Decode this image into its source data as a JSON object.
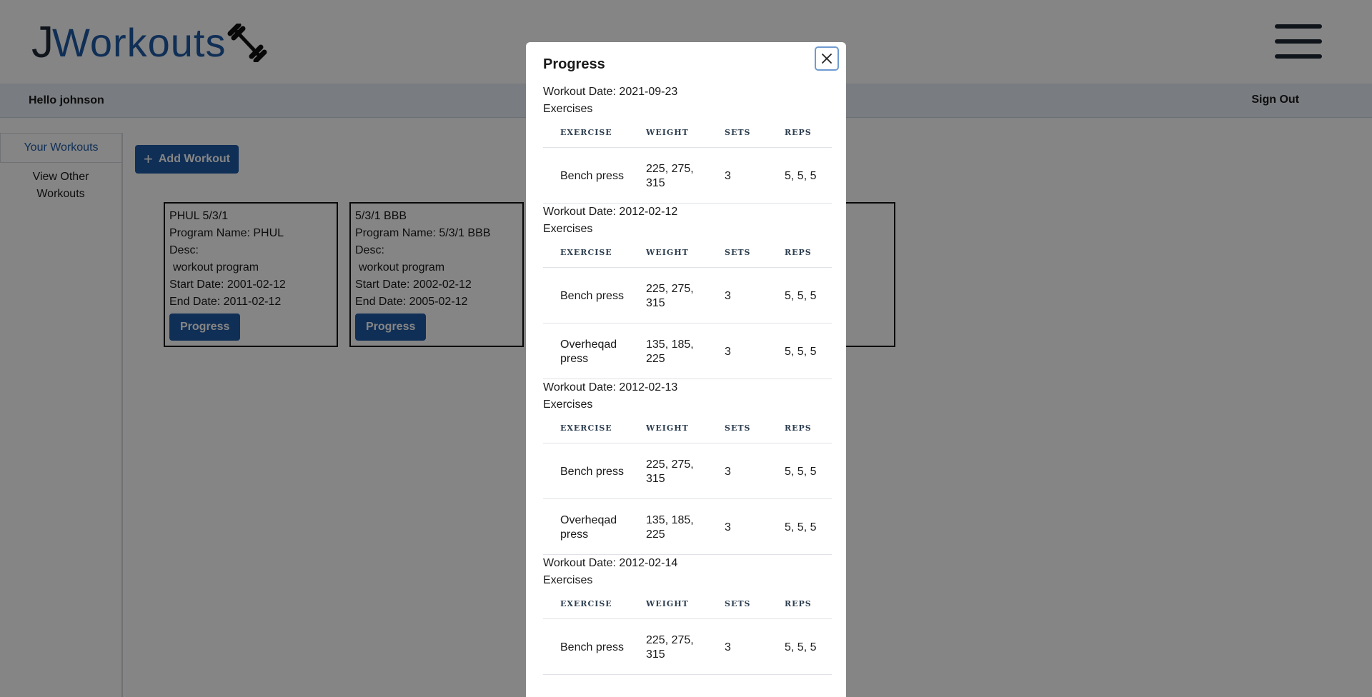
{
  "brand": {
    "logo_j": "J",
    "logo_rest": "Workouts"
  },
  "header": {
    "greeting": "Hello johnson",
    "sign_out": "Sign Out"
  },
  "sidebar": {
    "items": [
      {
        "label": "Your Workouts",
        "active": true
      },
      {
        "label": "View Other Workouts",
        "active": false
      }
    ]
  },
  "main": {
    "add_button": "Add Workout",
    "cards": [
      {
        "title": "PHUL 5/3/1",
        "program": "Program Name: PHUL",
        "desc_label": "Desc:",
        "desc": "workout program",
        "start": "Start Date: 2001-02-12",
        "end": "End Date: 2011-02-12",
        "button": "Progress"
      },
      {
        "title": "5/3/1 BBB",
        "program": "Program Name: 5/3/1 BBB",
        "desc_label": "Desc:",
        "desc": "workout program",
        "start": "Start Date: 2002-02-12",
        "end": "End Date: 2005-02-12",
        "button": "Progress"
      }
    ]
  },
  "modal": {
    "title": "Progress",
    "exercises_label": "Exercises",
    "columns": [
      "EXERCISE",
      "WEIGHT",
      "SETS",
      "REPS"
    ],
    "sessions": [
      {
        "date": "Workout Date: 2021-09-23",
        "rows": [
          {
            "exercise": "Bench press",
            "weight": "225, 275, 315",
            "sets": "3",
            "reps": "5, 5, 5"
          }
        ]
      },
      {
        "date": "Workout Date: 2012-02-12",
        "rows": [
          {
            "exercise": "Bench press",
            "weight": "225, 275, 315",
            "sets": "3",
            "reps": "5, 5, 5"
          },
          {
            "exercise": "Overheqad press",
            "weight": "135, 185, 225",
            "sets": "3",
            "reps": "5, 5, 5"
          }
        ]
      },
      {
        "date": "Workout Date: 2012-02-13",
        "rows": [
          {
            "exercise": "Bench press",
            "weight": "225, 275, 315",
            "sets": "3",
            "reps": "5, 5, 5"
          },
          {
            "exercise": "Overheqad press",
            "weight": "135, 185, 225",
            "sets": "3",
            "reps": "5, 5, 5"
          }
        ]
      },
      {
        "date": "Workout Date: 2012-02-14",
        "rows": [
          {
            "exercise": "Bench press",
            "weight": "225, 275, 315",
            "sets": "3",
            "reps": "5, 5, 5"
          }
        ]
      }
    ]
  },
  "colors": {
    "brand_blue": "#1f5aa6",
    "dark": "#1f2937",
    "overlay": "rgba(0,0,0,0.48)"
  },
  "icons": {
    "logo": "barbell-icon",
    "menu": "hamburger-menu-icon",
    "add": "plus-icon",
    "close": "close-icon"
  }
}
